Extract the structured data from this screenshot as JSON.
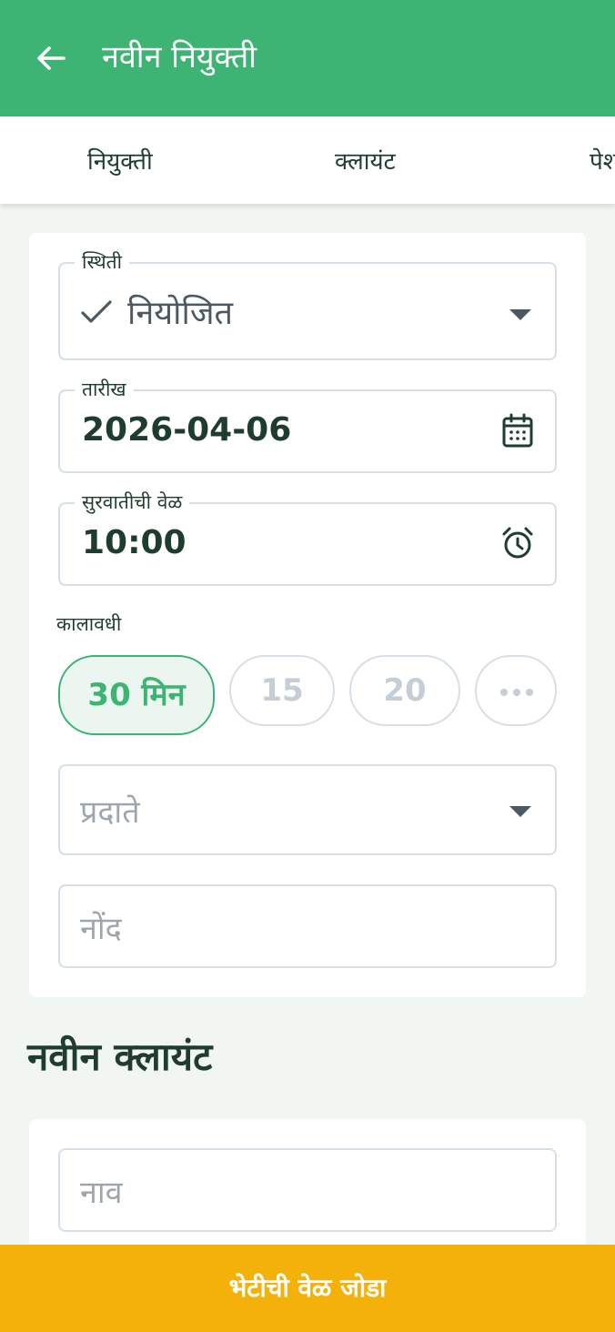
{
  "appbar": {
    "title": "नवीन नियुक्ती",
    "back_icon": "arrow-left-icon",
    "color": "#3db374"
  },
  "tabs": [
    {
      "label": "नियुक्ती"
    },
    {
      "label": "क्लायंट"
    },
    {
      "label": "पेश"
    }
  ],
  "appointment": {
    "status": {
      "label": "स्थिती",
      "value": "नियोजित",
      "icon": "check-icon"
    },
    "date": {
      "label": "तारीख",
      "value": "2026-04-06",
      "icon": "calendar-icon"
    },
    "start_time": {
      "label": "सुरवातीची वेळ",
      "value": "10:00",
      "icon": "alarm-icon"
    },
    "duration": {
      "label": "कालावधी",
      "options": [
        {
          "label": "30 मिन",
          "selected": true
        },
        {
          "label": "15",
          "selected": false
        },
        {
          "label": "20",
          "selected": false
        }
      ],
      "more_icon": "more-horizontal-icon"
    },
    "provider": {
      "placeholder": "प्रदाते"
    },
    "note": {
      "placeholder": "नोंद"
    }
  },
  "new_client": {
    "title": "नवीन क्लायंट",
    "name": {
      "placeholder": "नाव"
    }
  },
  "footer": {
    "button_label": "भेटीची वेळ जोडा",
    "color": "#f4b10a"
  }
}
